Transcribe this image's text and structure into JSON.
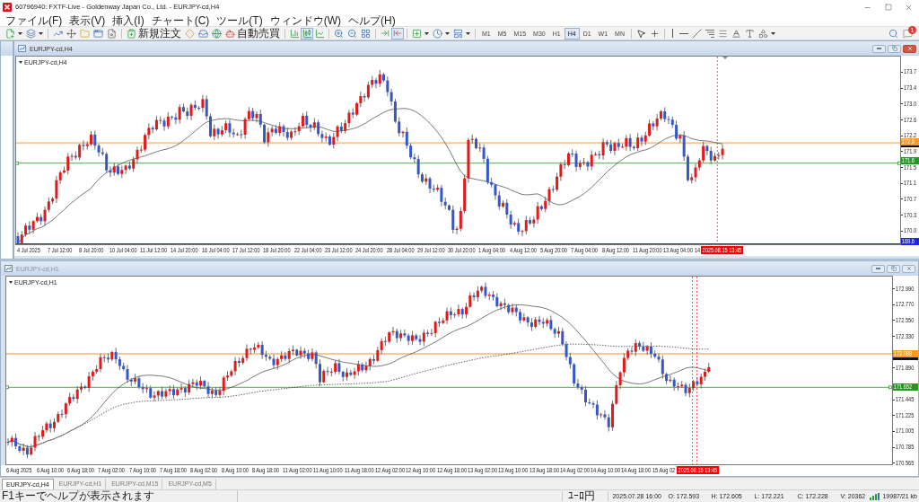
{
  "window": {
    "title": "60796940: FXTF-Live - Goldenway Japan Co., Ltd. - EURJPY-cd,H4"
  },
  "menu": [
    "ファイル(F)",
    "表示(V)",
    "挿入(I)",
    "チャート(C)",
    "ツール(T)",
    "ウィンドウ(W)",
    "ヘルプ(H)"
  ],
  "toolbar": {
    "new_order": "新規注文",
    "auto_trading": "自動売買",
    "chart_types": [
      {
        "kind": "bars",
        "selected": false
      },
      {
        "kind": "candles",
        "selected": true
      },
      {
        "kind": "line",
        "selected": false
      }
    ],
    "auto_scroll": {
      "on": false
    },
    "chart_shift": {
      "on": true
    },
    "timeframes": [
      {
        "label": "M1",
        "selected": false
      },
      {
        "label": "M5",
        "selected": false
      },
      {
        "label": "M15",
        "selected": false
      },
      {
        "label": "M30",
        "selected": false
      },
      {
        "label": "H1",
        "selected": false
      },
      {
        "label": "H4",
        "selected": true
      },
      {
        "label": "D1",
        "selected": false
      },
      {
        "label": "W1",
        "selected": false
      },
      {
        "label": "MN",
        "selected": false
      }
    ],
    "notification_count": "1"
  },
  "chart_windows": [
    {
      "title": "EURJPY-cd,H4",
      "active": true,
      "symbol": "EURJPY-cd,H4",
      "price_labels": [
        "173.7",
        "173.4",
        "173.0",
        "172.6",
        "172.2",
        "171.9",
        "171.5",
        "171.1",
        "170.7",
        "170.3",
        "170.0"
      ],
      "price_tags": [
        {
          "text": "172.0",
          "color": "#f39a2e",
          "line": true
        },
        {
          "color": "#111111",
          "line": false
        },
        {
          "text": "171.6",
          "color": "#229a22",
          "line": true
        },
        {
          "text": "169.6",
          "color": "#2323ee",
          "line": true
        }
      ],
      "time_labels": [
        "4 Jul 2025",
        "7 Jul 12:00",
        "8 Jul 20:00",
        "10 Jul 04:00",
        "11 Jul 12:00",
        "14 Jul 20:00",
        "16 Jul 04:00",
        "17 Jul 12:00",
        "18 Jul 20:00",
        "22 Jul 04:00",
        "23 Jul 12:00",
        "24 Jul 20:00",
        "28 Jul 04:00",
        "29 Jul 12:00",
        "30 Jul 20:00",
        "1 Aug 04:00",
        "4 Aug 12:00",
        "5 Aug 20:00",
        "7 Aug 04:00",
        "8 Aug 12:00",
        "11 Aug 20:00",
        "13 Aug 04:00",
        "14"
      ],
      "time_marker": "2025.08.15 13:45"
    },
    {
      "title": "EURJPY-cd,H1",
      "active": false,
      "symbol": "EURJPY-cd,H1",
      "price_labels": [
        "172.990",
        "172.770",
        "172.550",
        "172.330",
        "171.890",
        "171.445",
        "171.225",
        "171.005",
        "170.785",
        "170.565"
      ],
      "price_tags": [
        {
          "text": "172.088",
          "color": "#f39a2e",
          "line": true
        },
        {
          "color": "#111111",
          "line": false
        },
        {
          "text": "171.652",
          "color": "#229a22",
          "line": true
        }
      ],
      "time_labels": [
        "6 Aug 2025",
        "6 Aug 10:00",
        "6 Aug 18:00",
        "7 Aug 02:00",
        "7 Aug 10:00",
        "7 Aug 18:00",
        "8 Aug 02:00",
        "8 Aug 10:00",
        "8 Aug 18:00",
        "11 Aug 02:00",
        "11 Aug 10:00",
        "11 Aug 18:00",
        "12 Aug 02:00",
        "12 Aug 10:00",
        "12 Aug 18:00",
        "13 Aug 02:00",
        "13 Aug 10:00",
        "13 Aug 18:00",
        "14 Aug 02:00",
        "14 Aug 10:00",
        "14 Aug 18:00",
        "15 Aug 02"
      ],
      "time_marker": "2025.08.15 13:45"
    }
  ],
  "tabs": [
    {
      "label": "EURJPY-cd,H4",
      "selected": true
    },
    {
      "label": "EURJPY-cd,H1",
      "selected": false
    },
    {
      "label": "EURJPY-cd,M15",
      "selected": false
    },
    {
      "label": "EURJPY-cd,M5",
      "selected": false
    }
  ],
  "status_bar": {
    "help": "F1キーでヘルプが表示されます",
    "profile": "ﾕｰﾛ円",
    "datetime": "2025.07.28 16:00",
    "open": "O: 172.593",
    "high": "H: 172.605",
    "low": "L: 172.221",
    "close": "C: 172.228",
    "volume": "V: 20362",
    "traffic": "19987/21 kb"
  }
}
